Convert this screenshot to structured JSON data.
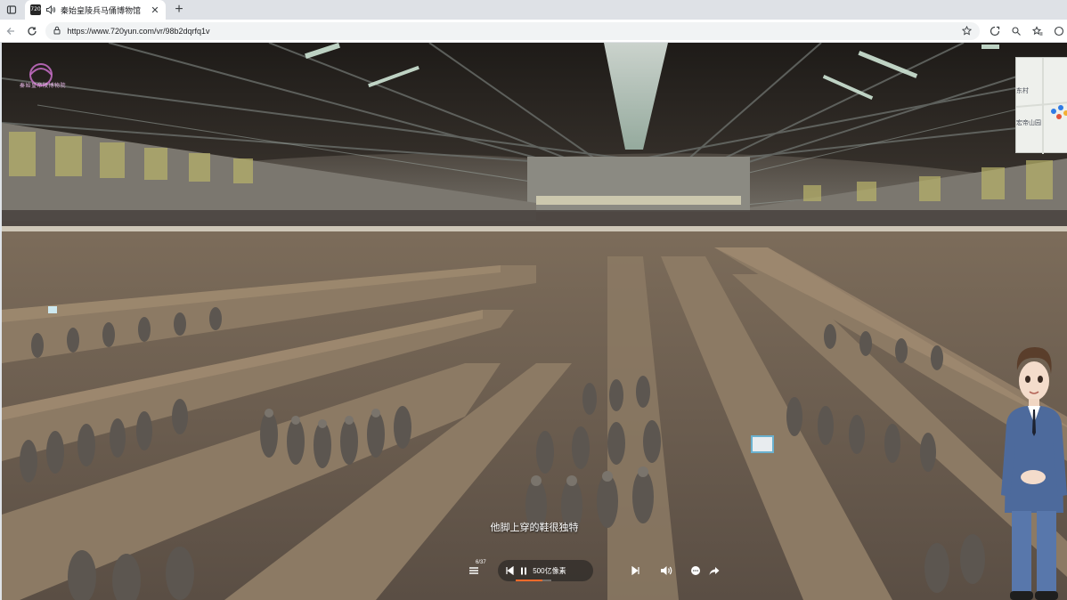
{
  "browser": {
    "tab": {
      "favicon_text": "720",
      "title": "秦始皇陵兵马俑博物馆",
      "close_symbol": "✕"
    },
    "new_tab_symbol": "+",
    "address": {
      "url": "https://www.720yun.com/vr/98b2dqrfq1v"
    }
  },
  "tour": {
    "logo_text": "秦始皇帝陵博物院",
    "minimap": {
      "label_top": "东村",
      "label_bottom": "宏帝山园"
    },
    "caption": "他脚上穿的鞋很独特",
    "controls": {
      "playlist_count": "6/37",
      "track_label": "500亿像素",
      "progress": 0.75
    }
  },
  "colors": {
    "progress_accent": "#ff6a2a",
    "minimap_marker": "#2f7be5"
  }
}
